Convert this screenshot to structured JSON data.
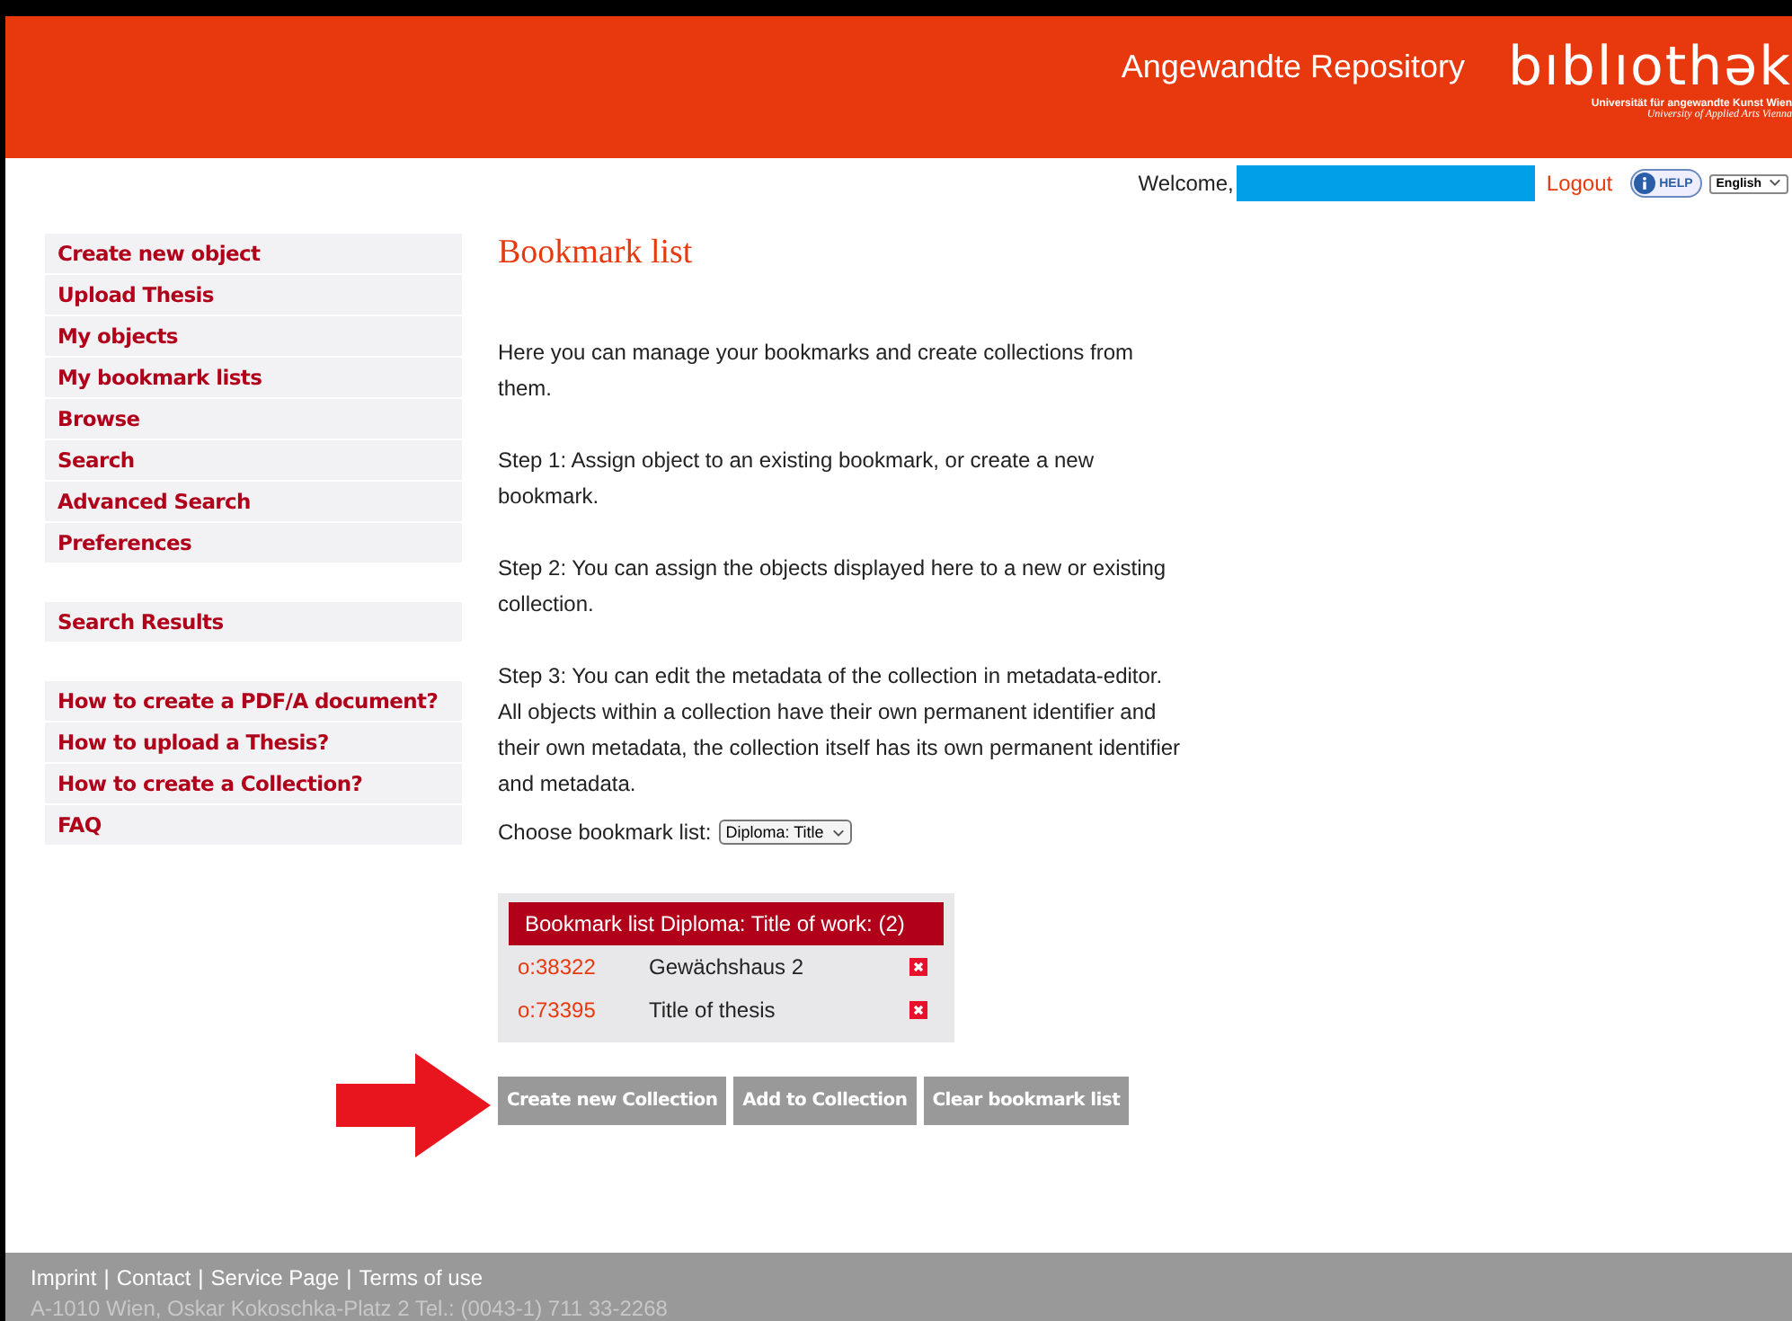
{
  "header": {
    "site_title": "Angewandte Repository",
    "logo": {
      "wordmark": "bıblıothək",
      "line_1": "Universität für angewandte Kunst Wien",
      "line_2": "University of Applied Arts Vienna"
    }
  },
  "userbar": {
    "welcome": "Welcome,",
    "logout": "Logout",
    "help": "HELP",
    "language": "English"
  },
  "sidebar": {
    "groups": [
      {
        "items": [
          "Create new object",
          "Upload Thesis",
          "My objects",
          "My bookmark lists",
          "Browse",
          "Search",
          "Advanced Search",
          "Preferences"
        ]
      },
      {
        "items": [
          "Search Results"
        ]
      },
      {
        "items": [
          "How to create a PDF/A document?",
          "How to upload a Thesis?",
          "How to create a Collection?",
          "FAQ"
        ]
      }
    ]
  },
  "main": {
    "heading": "Bookmark list",
    "paragraphs": [
      "Here you can manage your bookmarks and create collections from them.",
      "Step 1: Assign object to an existing bookmark, or create a new bookmark.",
      "Step 2: You can assign the objects displayed here to a new or existing collection.",
      "Step 3: You can edit the metadata of the collection in metadata-editor. All objects within a collection have their own permanent identifier and their own metadata, the collection itself has its own permanent identifier and metadata."
    ],
    "choose_label": "Choose bookmark list:",
    "choose_value": "Diploma: Title",
    "table": {
      "title": "Bookmark list Diploma: Title of work: (2)",
      "rows": [
        {
          "id": "o:38322",
          "title": "Gewächshaus 2"
        },
        {
          "id": "o:73395",
          "title": "Title of thesis"
        }
      ]
    },
    "buttons": [
      "Create new Collection",
      "Add to Collection",
      "Clear bookmark list"
    ]
  },
  "footer": {
    "links": [
      "Imprint",
      "Contact",
      "Service Page",
      "Terms of use"
    ],
    "separator": "|",
    "address": "A-1010 Wien, Oskar Kokoschka-Platz 2 Tel.: (0043-1) 711 33-2268"
  }
}
